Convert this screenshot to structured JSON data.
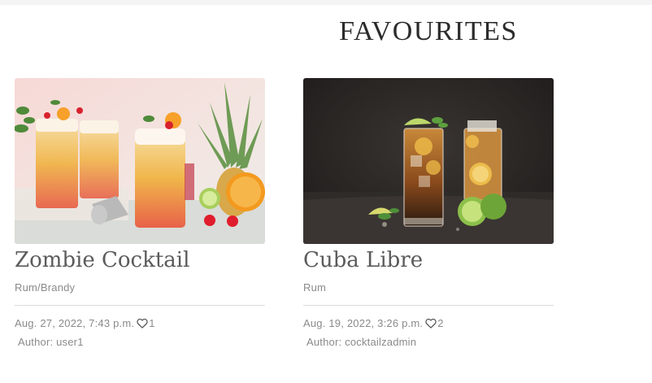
{
  "page": {
    "title": "FAVOURITES"
  },
  "cards": [
    {
      "title": "Zombie Cocktail",
      "category": "Rum/Brandy",
      "date": "Aug. 27, 2022, 7:43 p.m.",
      "likes": "1",
      "author": "Author: user1",
      "icon": "heart-outline-icon"
    },
    {
      "title": "Cuba Libre",
      "category": "Rum",
      "date": "Aug. 19, 2022, 3:26 p.m.",
      "likes": "2",
      "author": "Author: cocktailzadmin",
      "icon": "heart-outline-icon"
    }
  ],
  "colors": {
    "title": "#2b2b2b",
    "card_title": "#5b5b5b",
    "muted_text": "#8a8a8a",
    "divider": "#dcdcdc"
  }
}
